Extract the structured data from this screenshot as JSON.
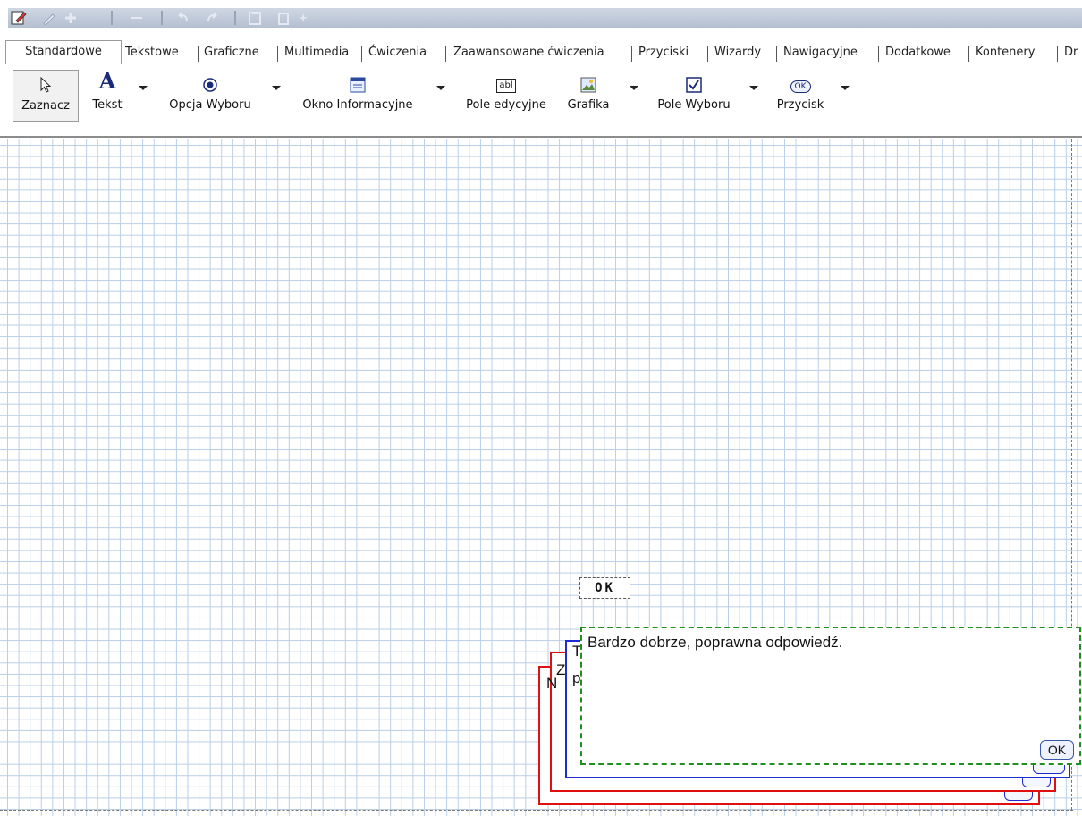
{
  "tabs": [
    {
      "label": "Standardowe",
      "active": true
    },
    {
      "label": "Tekstowe"
    },
    {
      "label": "Graficzne"
    },
    {
      "label": "Multimedia"
    },
    {
      "label": "Ćwiczenia"
    },
    {
      "label": "Zaawansowane ćwiczenia"
    },
    {
      "label": "Przyciski"
    },
    {
      "label": "Wizardy"
    },
    {
      "label": "Nawigacyjne"
    },
    {
      "label": "Dodatkowe"
    },
    {
      "label": "Kontenery"
    },
    {
      "label": "Dr"
    }
  ],
  "ribbon": {
    "items": [
      {
        "label": "Zaznacz",
        "icon": "cursor-icon"
      },
      {
        "label": "Tekst",
        "icon": "text-a-icon"
      },
      {
        "label": "Opcja Wyboru",
        "icon": "radio-icon"
      },
      {
        "label": "Okno Informacyjne",
        "icon": "window-icon"
      },
      {
        "label": "Pole edycyjne",
        "icon": "textbox-icon"
      },
      {
        "label": "Grafika",
        "icon": "image-icon"
      },
      {
        "label": "Pole Wyboru",
        "icon": "checkbox-icon"
      },
      {
        "label": "Przycisk",
        "icon": "ok-button-icon"
      }
    ],
    "icon_text": {
      "textbox": "abl",
      "ok": "OK",
      "tekst": "A"
    }
  },
  "canvas": {
    "ok_button_label": "OK",
    "feedback": {
      "message": "Bardzo dobrze, poprawna odpowiedź.",
      "ok_label": "OK",
      "peek_letters": [
        "N",
        "Z",
        "T",
        "p"
      ]
    }
  },
  "colors": {
    "grid": "#b8cde6",
    "red": "#e01010",
    "blue": "#1e2bd0",
    "green": "#1f8f1f"
  }
}
